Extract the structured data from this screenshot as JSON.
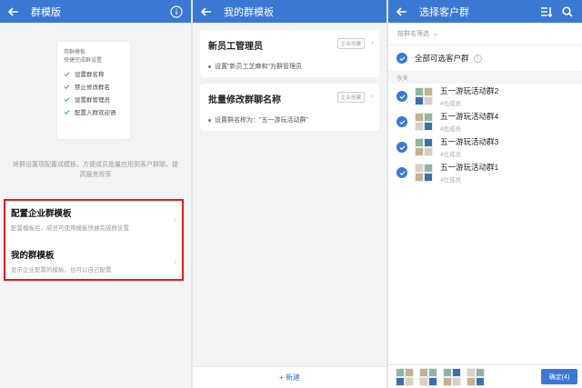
{
  "panel1": {
    "title": "群模版",
    "card_heading_1": "用群模板",
    "card_heading_2": "快捷完成群设置",
    "card_items": [
      "设置群名称",
      "禁止修改群名",
      "设置群管理员",
      "配置入群欢迎语"
    ],
    "description": "将群设置项配置成模板，方便成员批量应用到客户群聊，提高服务效率",
    "menu": [
      {
        "title": "配置企业群模板",
        "subtitle": "配置模板后，成员可使用模板快捷完成群设置"
      },
      {
        "title": "我的群模板",
        "subtitle": "显示企业配置的模板，也可以自己配置"
      }
    ]
  },
  "panel2": {
    "title": "我的群模板",
    "templates": [
      {
        "name": "新员工管理员",
        "tag": "企业创建",
        "detail": "设置\"新员工芝麻和\"为群管理员"
      },
      {
        "name": "批量修改群聊名称",
        "tag": "企业创建",
        "detail": "设置群名称为：\"五一游玩活动群\""
      }
    ],
    "new_button": "+ 新建"
  },
  "panel3": {
    "title": "选择客户群",
    "filter_label": "按群名筛选",
    "select_all": "全部可选客户群",
    "section_label": "今天",
    "groups": [
      {
        "name": "五一游玩活动群2",
        "count": "4位成员"
      },
      {
        "name": "五一游玩活动群4",
        "count": "4位成员"
      },
      {
        "name": "五一游玩活动群3",
        "count": "4位成员"
      },
      {
        "name": "五一游玩活动群1",
        "count": "4位成员"
      }
    ],
    "confirm_button": "确定(4)"
  },
  "colors": {
    "accent": "#3b78d4",
    "highlight_border": "#e21c1c"
  }
}
